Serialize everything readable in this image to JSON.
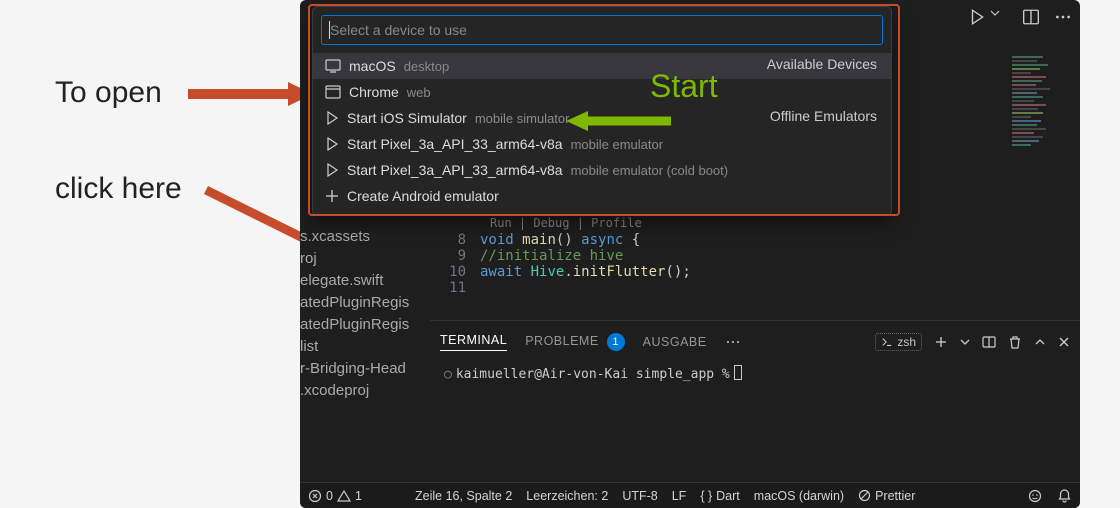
{
  "annotations": {
    "open": "To open",
    "click_here": "click here",
    "start": "Start"
  },
  "palette": {
    "placeholder": "Select a device to use",
    "sections": {
      "available": "Available Devices",
      "offline": "Offline Emulators"
    },
    "items": [
      {
        "label": "macOS",
        "sub": "desktop"
      },
      {
        "label": "Chrome",
        "sub": "web"
      },
      {
        "label": "Start iOS Simulator",
        "sub": "mobile simulator"
      },
      {
        "label": "Start Pixel_3a_API_33_arm64-v8a",
        "sub": "mobile emulator"
      },
      {
        "label": "Start Pixel_3a_API_33_arm64-v8a",
        "sub": "mobile emulator (cold boot)"
      },
      {
        "label": "Create Android emulator",
        "sub": ""
      }
    ]
  },
  "sidebar_files": [
    "s.xcassets",
    "roj",
    "elegate.swift",
    "atedPluginRegis",
    "atedPluginRegis",
    "list",
    "r-Bridging-Head",
    ".xcodeproj"
  ],
  "code": {
    "run_links": "Run | Debug | Profile",
    "lines": [
      {
        "n": "8",
        "html": "<span class='tk-kw'>void</span> <span class='tk-fn'>main</span>() <span class='tk-kw'>async</span> {"
      },
      {
        "n": "9",
        "html": "  <span class='tk-cm'>//initialize hive</span>"
      },
      {
        "n": "10",
        "html": "  <span class='tk-kw'>await</span> <span class='tk-var'>Hive</span>.<span class='tk-fn'>initFlutter</span>();"
      },
      {
        "n": "11",
        "html": ""
      }
    ]
  },
  "terminal": {
    "tabs": {
      "terminal": "TERMINAL",
      "problems": "PROBLEME",
      "problems_count": "1",
      "output": "AUSGABE"
    },
    "shell": "zsh",
    "prompt": "kaimueller@Air-von-Kai simple_app %"
  },
  "statusbar": {
    "errors": "0",
    "warnings": "1",
    "cursor": "Zeile 16, Spalte 2",
    "spaces": "Leerzeichen: 2",
    "encoding": "UTF-8",
    "eol": "LF",
    "lang": "Dart",
    "device": "macOS (darwin)",
    "prettier": "Prettier"
  }
}
